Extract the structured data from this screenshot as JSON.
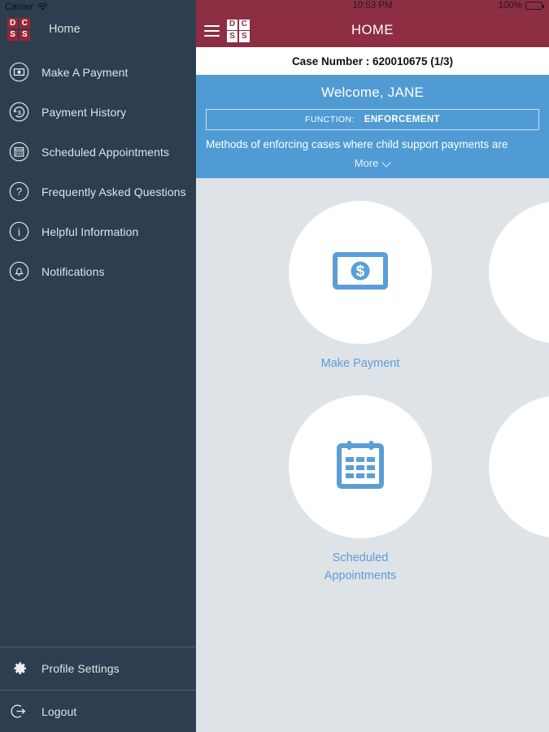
{
  "status_left": {
    "carrier": "Carrier",
    "wifi_icon": "wifi-icon"
  },
  "sidebar": {
    "logo": {
      "letters": [
        "D",
        "C",
        "S",
        "S"
      ],
      "name": "dcss-logo"
    },
    "home_label": "Home",
    "items": [
      {
        "label": "Make A Payment",
        "icon": "money-bill-circle-icon",
        "name": "sidebar-item-make-a-payment"
      },
      {
        "label": "Payment History",
        "icon": "payment-history-circle-icon",
        "name": "sidebar-item-payment-history"
      },
      {
        "label": "Scheduled Appointments",
        "icon": "calendar-circle-icon",
        "name": "sidebar-item-scheduled-appointments"
      },
      {
        "label": "Frequently Asked Questions",
        "icon": "question-circle-icon",
        "name": "sidebar-item-faq"
      },
      {
        "label": "Helpful Information",
        "icon": "info-circle-icon",
        "name": "sidebar-item-helpful-information"
      },
      {
        "label": "Notifications",
        "icon": "bell-circle-icon",
        "name": "sidebar-item-notifications"
      }
    ],
    "bottom_items": [
      {
        "label": "Profile Settings",
        "icon": "gear-icon",
        "name": "sidebar-item-profile-settings"
      },
      {
        "label": "Logout",
        "icon": "logout-icon",
        "name": "sidebar-item-logout"
      }
    ]
  },
  "statusbar": {
    "time": "10:53 PM",
    "battery_percent": "100%",
    "battery_icon": "battery-full-icon"
  },
  "appbar": {
    "menu_icon": "hamburger-menu-icon",
    "logo_letters": [
      "D",
      "C",
      "S",
      "S"
    ],
    "title": "HOME"
  },
  "case": {
    "text": "Case Number : 620010675 (1/3)"
  },
  "welcome": {
    "greeting": "Welcome, JANE",
    "function_label": "FUNCTION:",
    "function_value": "ENFORCEMENT",
    "description": "Methods of enforcing cases where child support payments are",
    "more_label": "More",
    "more_icon": "chevron-down-icon"
  },
  "tiles": [
    {
      "label": "Make Payment",
      "icon": "money-bill-icon",
      "name": "tile-make-payment"
    },
    {
      "label": "",
      "icon": "",
      "name": "tile-partial-right-top"
    },
    {
      "label": "Scheduled\nAppointments",
      "label_line1": "Scheduled",
      "label_line2": "Appointments",
      "icon": "calendar-icon",
      "name": "tile-scheduled-appointments"
    },
    {
      "label": "",
      "icon": "",
      "name": "tile-partial-right-bottom"
    }
  ],
  "colors": {
    "sidebar": "#2d3e50",
    "appbar_maroon": "#8e2e43",
    "banner_blue": "#509bd4",
    "content_gray": "#dee3e7",
    "accent_blue": "#5b9ed6",
    "logo_red": "#9b2435"
  }
}
